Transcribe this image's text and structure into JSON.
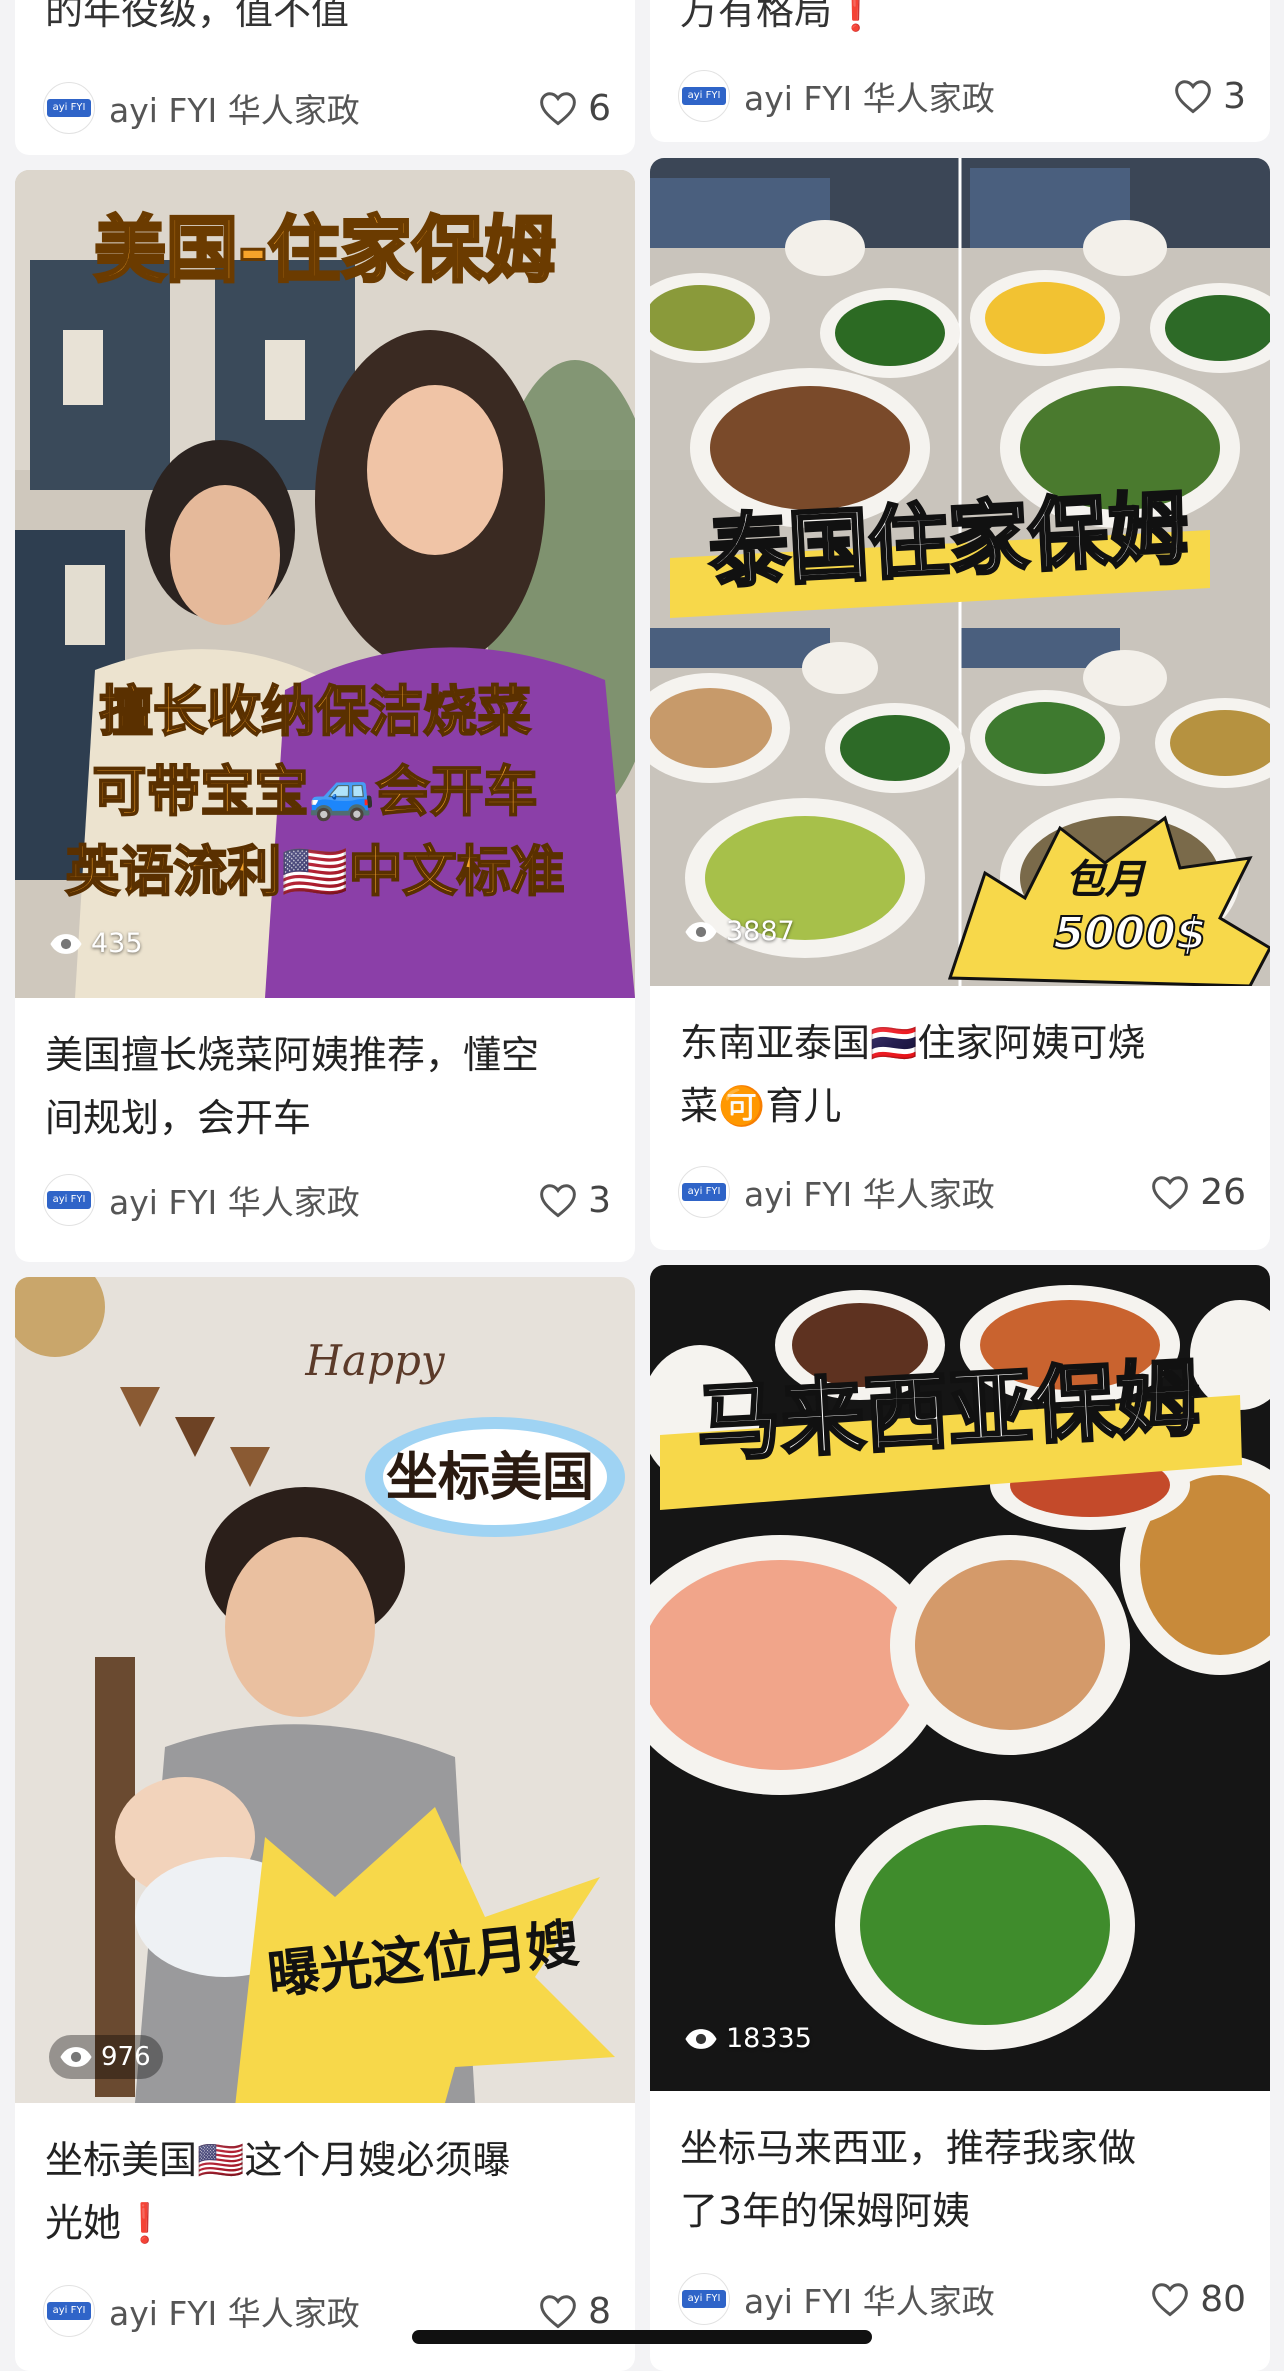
{
  "feed": {
    "left": [
      {
        "title": "的年役级，值不值",
        "author": "ayi FYI 华人家政",
        "likes": "6"
      },
      {
        "cover_caption_top": "美国-住家保姆",
        "cover_lines": [
          "擅长收纳保洁烧菜",
          "可带宝宝🚙会开车",
          "英语流利🇺🇸中文标准"
        ],
        "views": "435",
        "title_line1": "美国擅长烧菜阿姨推荐，懂空",
        "title_line2": "间规划，会开车",
        "author": "ayi FYI 华人家政",
        "likes": "3"
      },
      {
        "cover_happy": "Happy",
        "cover_tag": "坐标美国",
        "cover_burst": "曝光这位月嫂",
        "views": "976",
        "title_line1": "坐标美国🇺🇸这个月嫂必须曝",
        "title_line2": "光她❗",
        "author": "ayi FYI 华人家政",
        "likes": "8"
      }
    ],
    "right": [
      {
        "title": "万有格局❗",
        "author": "ayi FYI 华人家政",
        "likes": "3"
      },
      {
        "cover_banner": "泰国住家保姆",
        "cover_burst_line1": "包月",
        "cover_burst_line2": "5000$",
        "views": "3887",
        "title_line1": "东南亚泰国🇹🇭住家阿姨可烧",
        "title_line2": "菜🉑育儿",
        "author": "ayi FYI 华人家政",
        "likes": "26"
      },
      {
        "cover_banner": "马来西亚保姆",
        "views": "18335",
        "title_line1": "坐标马来西亚，推荐我家做",
        "title_line2": "了3年的保姆阿姨",
        "author": "ayi FYI 华人家政",
        "likes": "80"
      }
    ]
  },
  "avatar_badge": "ayi FYI",
  "colors": {
    "accent_yellow": "#f7d84a",
    "orange_text": "#f6a32a",
    "card_bg": "#ffffff",
    "page_bg": "#f3f3f5"
  },
  "icons": {
    "likes": "heart-outline-icon",
    "views": "eye-icon"
  }
}
